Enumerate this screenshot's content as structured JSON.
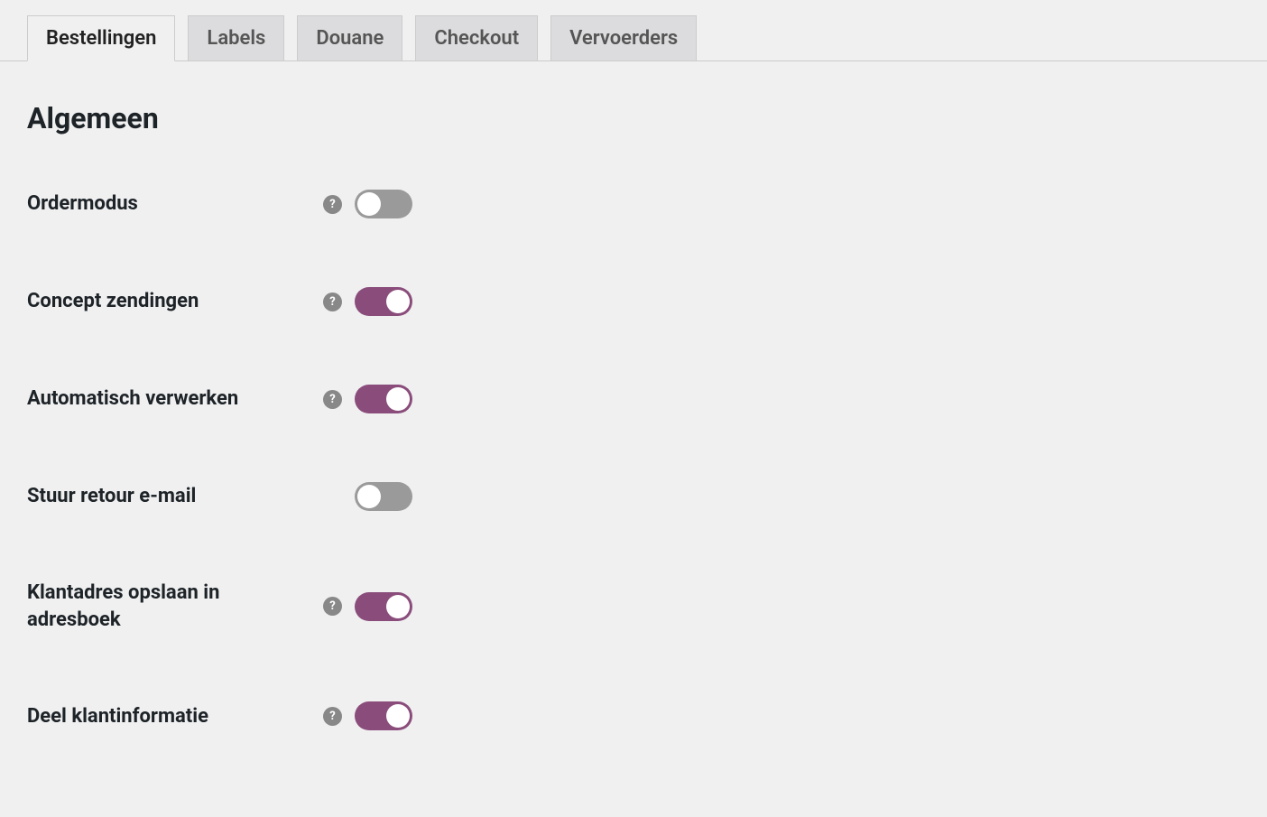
{
  "tabs": [
    {
      "label": "Bestellingen",
      "active": true
    },
    {
      "label": "Labels",
      "active": false
    },
    {
      "label": "Douane",
      "active": false
    },
    {
      "label": "Checkout",
      "active": false
    },
    {
      "label": "Vervoerders",
      "active": false
    }
  ],
  "section_title": "Algemeen",
  "settings": [
    {
      "key": "ordermodus",
      "label": "Ordermodus",
      "help": true,
      "on": false
    },
    {
      "key": "concept-zendingen",
      "label": "Concept zendingen",
      "help": true,
      "on": true
    },
    {
      "key": "automatisch-verwerken",
      "label": "Automatisch verwerken",
      "help": true,
      "on": true
    },
    {
      "key": "stuur-retour-email",
      "label": "Stuur retour e-mail",
      "help": false,
      "on": false
    },
    {
      "key": "klantadres-opslaan",
      "label": "Klantadres opslaan in adresboek",
      "help": true,
      "on": true
    },
    {
      "key": "deel-klantinformatie",
      "label": "Deel klantinformatie",
      "help": true,
      "on": true
    }
  ],
  "colors": {
    "accent": "#8a4d7b",
    "toggle_off": "#9a9a9a",
    "tab_inactive_bg": "#dcdcde",
    "body_bg": "#f0f0f1"
  }
}
